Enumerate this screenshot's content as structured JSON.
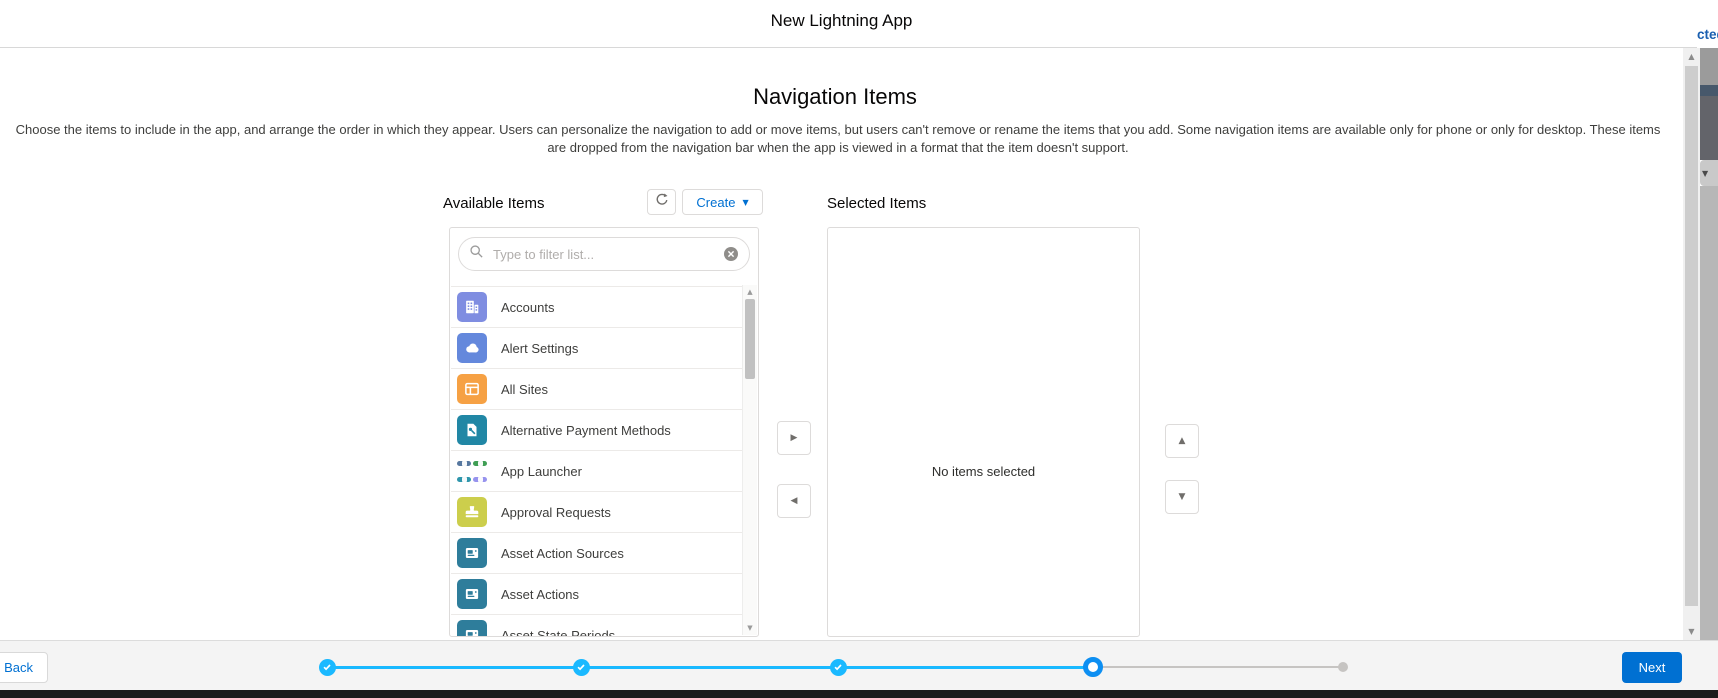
{
  "header": {
    "title": "New Lightning App"
  },
  "page": {
    "heading": "Navigation Items",
    "description": "Choose the items to include in the app, and arrange the order in which they appear. Users can personalize the navigation to add or move items, but users can't remove or rename the items that you add. Some navigation items are available only for phone or only for desktop. These items are dropped from the navigation bar when the app is viewed in a format that the item doesn't support."
  },
  "available": {
    "label": "Available Items",
    "create_button_label": "Create",
    "search": {
      "placeholder": "Type to filter list...",
      "value": ""
    },
    "items": [
      {
        "label": "Accounts",
        "icon": "building-icon",
        "color": "#7F8DE1"
      },
      {
        "label": "Alert Settings",
        "icon": "cloud-icon",
        "color": "#6488DC"
      },
      {
        "label": "All Sites",
        "icon": "window-layout-icon",
        "color": "#F6A144"
      },
      {
        "label": "Alternative Payment Methods",
        "icon": "document-wrench-icon",
        "color": "#2187A5"
      },
      {
        "label": "App Launcher",
        "icon": "app-grid-icon",
        "color": "grid",
        "grid_colors": [
          "#56779F",
          "#3F9E54",
          "#2F96AC",
          "#9793EE"
        ]
      },
      {
        "label": "Approval Requests",
        "icon": "stamp-icon",
        "color": "#CCCE4C"
      },
      {
        "label": "Asset Action Sources",
        "icon": "asset-card-icon",
        "color": "#2E7D9B"
      },
      {
        "label": "Asset Actions",
        "icon": "asset-card-icon",
        "color": "#2E7D9B"
      },
      {
        "label": "Asset State Periods",
        "icon": "asset-card-icon",
        "color": "#2E7D9B"
      }
    ]
  },
  "selected": {
    "label": "Selected Items",
    "empty_text": "No items selected"
  },
  "footer": {
    "back_label": "Back",
    "next_label": "Next",
    "progress": {
      "total_steps": 5,
      "steps_completed": 3,
      "current_step": 4
    }
  },
  "backdrop": {
    "clipped_link_text": "cted"
  },
  "colors": {
    "brand_blue": "#0070D2",
    "progress_line": "#1AB9FF",
    "progress_ring": "#0D8FF2",
    "progress_pending": "#C6C4C2"
  }
}
